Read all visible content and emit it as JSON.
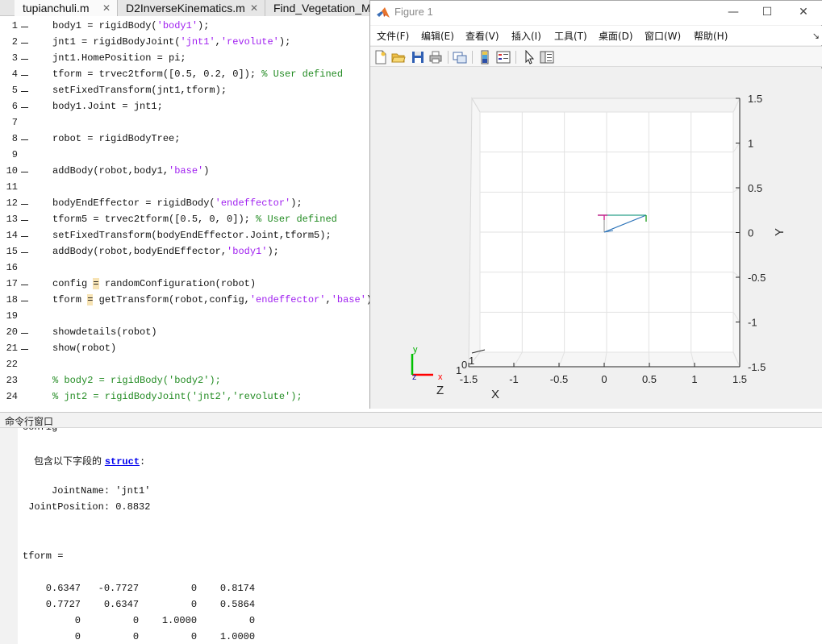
{
  "editor": {
    "tabs": [
      {
        "label": "tupianchuli.m",
        "close": "✕"
      },
      {
        "label": "D2InverseKinematics.m",
        "close": "✕"
      },
      {
        "label": "Find_Vegetation_Mu",
        "close": ""
      }
    ],
    "lines": [
      {
        "n": "1",
        "dash": true,
        "parts": [
          [
            "t",
            "body1 = rigidBody("
          ],
          [
            "s",
            "'body1'"
          ],
          [
            "t",
            ");"
          ]
        ]
      },
      {
        "n": "2",
        "dash": true,
        "parts": [
          [
            "t",
            "jnt1 = rigidBodyJoint("
          ],
          [
            "s",
            "'jnt1'"
          ],
          [
            "t",
            ","
          ],
          [
            "s",
            "'revolute'"
          ],
          [
            "t",
            ");"
          ]
        ]
      },
      {
        "n": "3",
        "dash": true,
        "parts": [
          [
            "t",
            "jnt1.HomePosition = pi;"
          ]
        ]
      },
      {
        "n": "4",
        "dash": true,
        "parts": [
          [
            "t",
            "tform = trvec2tform([0.5, 0.2, 0]); "
          ],
          [
            "c",
            "% User defined"
          ]
        ]
      },
      {
        "n": "5",
        "dash": true,
        "parts": [
          [
            "t",
            "setFixedTransform(jnt1,tform);"
          ]
        ]
      },
      {
        "n": "6",
        "dash": true,
        "parts": [
          [
            "t",
            "body1.Joint = jnt1;"
          ]
        ]
      },
      {
        "n": "7",
        "dash": false,
        "parts": []
      },
      {
        "n": "8",
        "dash": true,
        "parts": [
          [
            "t",
            "robot = rigidBodyTree;"
          ]
        ]
      },
      {
        "n": "9",
        "dash": false,
        "parts": []
      },
      {
        "n": "10",
        "dash": true,
        "parts": [
          [
            "t",
            "addBody(robot,body1,"
          ],
          [
            "s",
            "'base'"
          ],
          [
            "t",
            ")"
          ]
        ]
      },
      {
        "n": "11",
        "dash": false,
        "parts": []
      },
      {
        "n": "12",
        "dash": true,
        "parts": [
          [
            "t",
            "bodyEndEffector = rigidBody("
          ],
          [
            "s",
            "'endeffector'"
          ],
          [
            "t",
            ");"
          ]
        ]
      },
      {
        "n": "13",
        "dash": true,
        "parts": [
          [
            "t",
            "tform5 = trvec2tform([0.5, 0, 0]); "
          ],
          [
            "c",
            "% User defined"
          ]
        ]
      },
      {
        "n": "14",
        "dash": true,
        "parts": [
          [
            "t",
            "setFixedTransform(bodyEndEffector.Joint,tform5);"
          ]
        ]
      },
      {
        "n": "15",
        "dash": true,
        "parts": [
          [
            "t",
            "addBody(robot,bodyEndEffector,"
          ],
          [
            "s",
            "'body1'"
          ],
          [
            "t",
            ");"
          ]
        ]
      },
      {
        "n": "16",
        "dash": false,
        "parts": []
      },
      {
        "n": "17",
        "dash": true,
        "parts": [
          [
            "t",
            "config "
          ],
          [
            "h",
            "="
          ],
          [
            "t",
            " randomConfiguration(robot)"
          ]
        ]
      },
      {
        "n": "18",
        "dash": true,
        "parts": [
          [
            "t",
            "tform "
          ],
          [
            "h",
            "="
          ],
          [
            "t",
            " getTransform(robot,config,"
          ],
          [
            "s",
            "'endeffector'"
          ],
          [
            "t",
            ","
          ],
          [
            "s",
            "'base'"
          ],
          [
            "t",
            ")"
          ]
        ]
      },
      {
        "n": "19",
        "dash": false,
        "parts": []
      },
      {
        "n": "20",
        "dash": true,
        "parts": [
          [
            "t",
            "showdetails(robot)"
          ]
        ]
      },
      {
        "n": "21",
        "dash": true,
        "parts": [
          [
            "t",
            "show(robot)"
          ]
        ]
      },
      {
        "n": "22",
        "dash": false,
        "parts": []
      },
      {
        "n": "23",
        "dash": false,
        "parts": [
          [
            "c",
            "% body2 = rigidBody('body2');"
          ]
        ]
      },
      {
        "n": "24",
        "dash": false,
        "parts": [
          [
            "c",
            "% jnt2 = rigidBodyJoint('jnt2','revolute');"
          ]
        ]
      }
    ]
  },
  "figure": {
    "title": "Figure 1",
    "controls": {
      "minimize": "—",
      "maximize": "☐",
      "close": "✕"
    },
    "menus": [
      "文件(F)",
      "编辑(E)",
      "查看(V)",
      "插入(I)",
      "工具(T)",
      "桌面(D)",
      "窗口(W)",
      "帮助(H)"
    ],
    "menu_overflow": "↘",
    "toolbar_icons": [
      "new-figure-icon",
      "open-file-icon",
      "save-icon",
      "print-icon",
      "link-plot-icon",
      "colorbar-icon",
      "legend-icon",
      "pointer-icon",
      "property-inspector-icon"
    ],
    "axes": {
      "x_ticks": [
        "-1.5",
        "-1",
        "-0.5",
        "0",
        "0.5",
        "1",
        "1.5"
      ],
      "y_ticks": [
        "1.5",
        "1",
        "0.5",
        "0",
        "-0.5",
        "-1",
        "-1.5"
      ],
      "x_label": "X",
      "y_label": "Y",
      "z_label": "Z",
      "z_ticks": [
        "1",
        "0",
        "1"
      ],
      "triad": {
        "x": "x",
        "y": "y",
        "z": "z"
      }
    }
  },
  "command": {
    "title": "命令行窗口",
    "cut_top": "config",
    "struct_prefix": "包含以下字段的 ",
    "struct_link": "struct",
    "struct_suffix": ":",
    "field1": "     JointName: 'jnt1'",
    "field2": " JointPosition: 0.8832",
    "tform_label": "tform =",
    "matrix": [
      "    0.6347   -0.7727         0    0.8174",
      "    0.7727    0.6347         0    0.5864",
      "         0         0    1.0000         0",
      "         0         0         0    1.0000"
    ]
  }
}
